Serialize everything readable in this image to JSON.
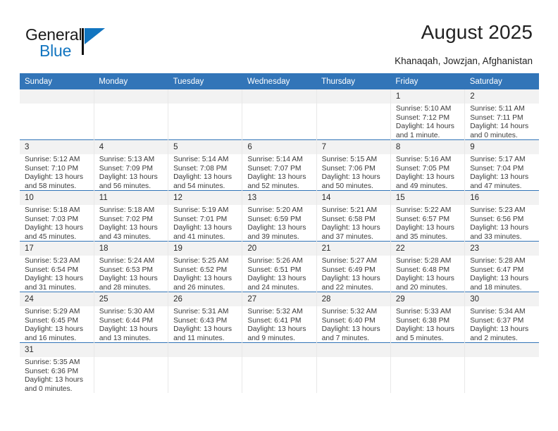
{
  "brand": {
    "name_top": "General",
    "name_bottom": "Blue",
    "accent_color": "#1275c0"
  },
  "header": {
    "title": "August 2025",
    "subtitle": "Khanaqah, Jowzjan, Afghanistan"
  },
  "theme": {
    "header_blue": "#3275b8",
    "daynum_band": "#f2f2f2",
    "text": "#2a2a2a"
  },
  "calendar": {
    "weekday_headers": [
      "Sunday",
      "Monday",
      "Tuesday",
      "Wednesday",
      "Thursday",
      "Friday",
      "Saturday"
    ],
    "labels": {
      "sunrise": "Sunrise:",
      "sunset": "Sunset:",
      "daylight": "Daylight:"
    },
    "weeks": [
      [
        {
          "day": "",
          "blank": true
        },
        {
          "day": "",
          "blank": true
        },
        {
          "day": "",
          "blank": true
        },
        {
          "day": "",
          "blank": true
        },
        {
          "day": "",
          "blank": true
        },
        {
          "day": "1",
          "sunrise": "Sunrise: 5:10 AM",
          "sunset": "Sunset: 7:12 PM",
          "daylight": "Daylight: 14 hours and 1 minute."
        },
        {
          "day": "2",
          "sunrise": "Sunrise: 5:11 AM",
          "sunset": "Sunset: 7:11 PM",
          "daylight": "Daylight: 14 hours and 0 minutes."
        }
      ],
      [
        {
          "day": "3",
          "sunrise": "Sunrise: 5:12 AM",
          "sunset": "Sunset: 7:10 PM",
          "daylight": "Daylight: 13 hours and 58 minutes."
        },
        {
          "day": "4",
          "sunrise": "Sunrise: 5:13 AM",
          "sunset": "Sunset: 7:09 PM",
          "daylight": "Daylight: 13 hours and 56 minutes."
        },
        {
          "day": "5",
          "sunrise": "Sunrise: 5:14 AM",
          "sunset": "Sunset: 7:08 PM",
          "daylight": "Daylight: 13 hours and 54 minutes."
        },
        {
          "day": "6",
          "sunrise": "Sunrise: 5:14 AM",
          "sunset": "Sunset: 7:07 PM",
          "daylight": "Daylight: 13 hours and 52 minutes."
        },
        {
          "day": "7",
          "sunrise": "Sunrise: 5:15 AM",
          "sunset": "Sunset: 7:06 PM",
          "daylight": "Daylight: 13 hours and 50 minutes."
        },
        {
          "day": "8",
          "sunrise": "Sunrise: 5:16 AM",
          "sunset": "Sunset: 7:05 PM",
          "daylight": "Daylight: 13 hours and 49 minutes."
        },
        {
          "day": "9",
          "sunrise": "Sunrise: 5:17 AM",
          "sunset": "Sunset: 7:04 PM",
          "daylight": "Daylight: 13 hours and 47 minutes."
        }
      ],
      [
        {
          "day": "10",
          "sunrise": "Sunrise: 5:18 AM",
          "sunset": "Sunset: 7:03 PM",
          "daylight": "Daylight: 13 hours and 45 minutes."
        },
        {
          "day": "11",
          "sunrise": "Sunrise: 5:18 AM",
          "sunset": "Sunset: 7:02 PM",
          "daylight": "Daylight: 13 hours and 43 minutes."
        },
        {
          "day": "12",
          "sunrise": "Sunrise: 5:19 AM",
          "sunset": "Sunset: 7:01 PM",
          "daylight": "Daylight: 13 hours and 41 minutes."
        },
        {
          "day": "13",
          "sunrise": "Sunrise: 5:20 AM",
          "sunset": "Sunset: 6:59 PM",
          "daylight": "Daylight: 13 hours and 39 minutes."
        },
        {
          "day": "14",
          "sunrise": "Sunrise: 5:21 AM",
          "sunset": "Sunset: 6:58 PM",
          "daylight": "Daylight: 13 hours and 37 minutes."
        },
        {
          "day": "15",
          "sunrise": "Sunrise: 5:22 AM",
          "sunset": "Sunset: 6:57 PM",
          "daylight": "Daylight: 13 hours and 35 minutes."
        },
        {
          "day": "16",
          "sunrise": "Sunrise: 5:23 AM",
          "sunset": "Sunset: 6:56 PM",
          "daylight": "Daylight: 13 hours and 33 minutes."
        }
      ],
      [
        {
          "day": "17",
          "sunrise": "Sunrise: 5:23 AM",
          "sunset": "Sunset: 6:54 PM",
          "daylight": "Daylight: 13 hours and 31 minutes."
        },
        {
          "day": "18",
          "sunrise": "Sunrise: 5:24 AM",
          "sunset": "Sunset: 6:53 PM",
          "daylight": "Daylight: 13 hours and 28 minutes."
        },
        {
          "day": "19",
          "sunrise": "Sunrise: 5:25 AM",
          "sunset": "Sunset: 6:52 PM",
          "daylight": "Daylight: 13 hours and 26 minutes."
        },
        {
          "day": "20",
          "sunrise": "Sunrise: 5:26 AM",
          "sunset": "Sunset: 6:51 PM",
          "daylight": "Daylight: 13 hours and 24 minutes."
        },
        {
          "day": "21",
          "sunrise": "Sunrise: 5:27 AM",
          "sunset": "Sunset: 6:49 PM",
          "daylight": "Daylight: 13 hours and 22 minutes."
        },
        {
          "day": "22",
          "sunrise": "Sunrise: 5:28 AM",
          "sunset": "Sunset: 6:48 PM",
          "daylight": "Daylight: 13 hours and 20 minutes."
        },
        {
          "day": "23",
          "sunrise": "Sunrise: 5:28 AM",
          "sunset": "Sunset: 6:47 PM",
          "daylight": "Daylight: 13 hours and 18 minutes."
        }
      ],
      [
        {
          "day": "24",
          "sunrise": "Sunrise: 5:29 AM",
          "sunset": "Sunset: 6:45 PM",
          "daylight": "Daylight: 13 hours and 16 minutes."
        },
        {
          "day": "25",
          "sunrise": "Sunrise: 5:30 AM",
          "sunset": "Sunset: 6:44 PM",
          "daylight": "Daylight: 13 hours and 13 minutes."
        },
        {
          "day": "26",
          "sunrise": "Sunrise: 5:31 AM",
          "sunset": "Sunset: 6:43 PM",
          "daylight": "Daylight: 13 hours and 11 minutes."
        },
        {
          "day": "27",
          "sunrise": "Sunrise: 5:32 AM",
          "sunset": "Sunset: 6:41 PM",
          "daylight": "Daylight: 13 hours and 9 minutes."
        },
        {
          "day": "28",
          "sunrise": "Sunrise: 5:32 AM",
          "sunset": "Sunset: 6:40 PM",
          "daylight": "Daylight: 13 hours and 7 minutes."
        },
        {
          "day": "29",
          "sunrise": "Sunrise: 5:33 AM",
          "sunset": "Sunset: 6:38 PM",
          "daylight": "Daylight: 13 hours and 5 minutes."
        },
        {
          "day": "30",
          "sunrise": "Sunrise: 5:34 AM",
          "sunset": "Sunset: 6:37 PM",
          "daylight": "Daylight: 13 hours and 2 minutes."
        }
      ],
      [
        {
          "day": "31",
          "sunrise": "Sunrise: 5:35 AM",
          "sunset": "Sunset: 6:36 PM",
          "daylight": "Daylight: 13 hours and 0 minutes."
        },
        {
          "day": "",
          "blank": true
        },
        {
          "day": "",
          "blank": true
        },
        {
          "day": "",
          "blank": true
        },
        {
          "day": "",
          "blank": true
        },
        {
          "day": "",
          "blank": true
        },
        {
          "day": "",
          "blank": true
        }
      ]
    ]
  }
}
